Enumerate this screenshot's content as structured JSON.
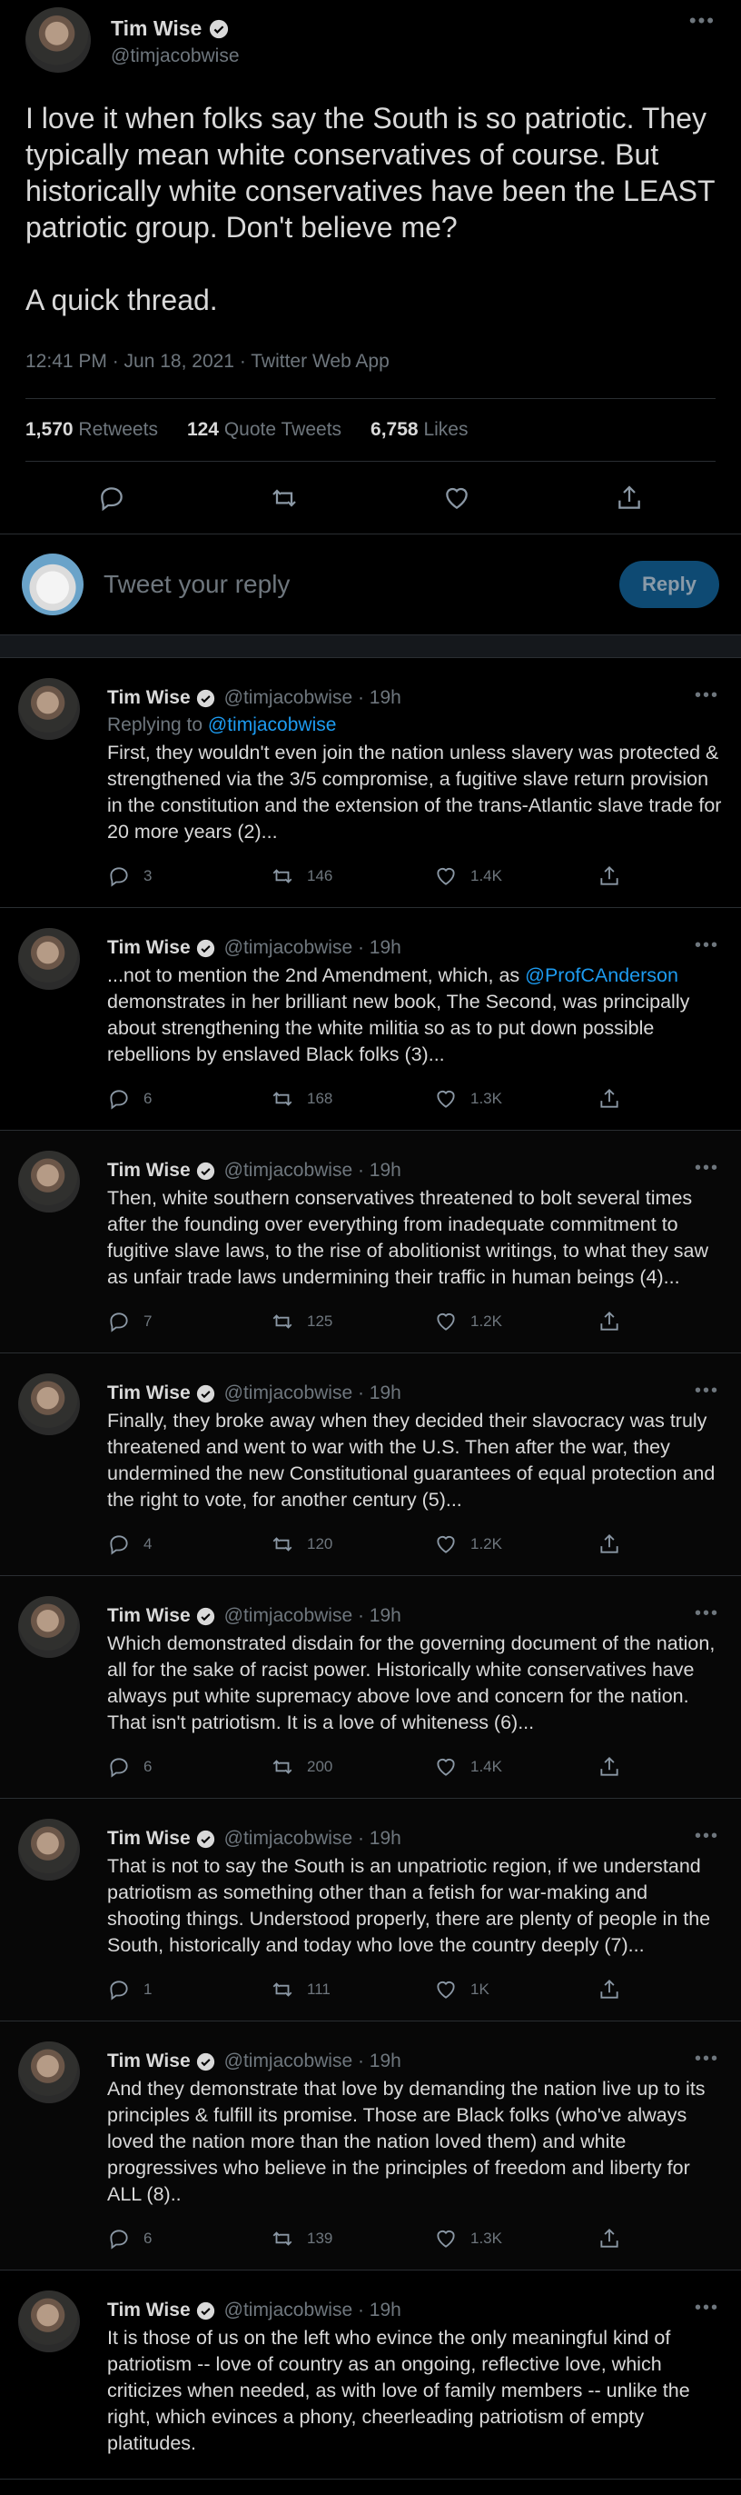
{
  "main": {
    "name": "Tim Wise",
    "handle": "@timjacobwise",
    "paragraphs": [
      "I love it when folks say the South is so patriotic. They typically mean white conservatives of course. But historically white conservatives have been the LEAST patriotic group. Don't believe me?",
      "A quick thread."
    ],
    "meta": "12:41 PM · Jun 18, 2021 · Twitter Web App",
    "retweets_count": "1,570",
    "retweets_label": "Retweets",
    "quotes_count": "124",
    "quotes_label": "Quote Tweets",
    "likes_count": "6,758",
    "likes_label": "Likes"
  },
  "reply_box": {
    "placeholder": "Tweet your reply",
    "button": "Reply"
  },
  "thread": [
    {
      "name": "Tim Wise",
      "handle": "@timjacobwise · 19h",
      "replying_prefix": "Replying to ",
      "replying_handle": "@timjacobwise",
      "text": "First, they wouldn't even join the nation unless slavery was protected & strengthened via the 3/5 compromise, a fugitive slave return provision in the constitution and the extension of the trans-Atlantic slave trade for 20 more years (2)...",
      "replies": "3",
      "retweets": "146",
      "likes": "1.4K"
    },
    {
      "name": "Tim Wise",
      "handle": "@timjacobwise · 19h",
      "text_before": "...not to mention the 2nd Amendment, which, as ",
      "mention": "@ProfCAnderson",
      "text_after": " demonstrates in her brilliant new book, The Second, was principally about strengthening the white militia so as to put down possible rebellions by enslaved Black folks (3)...",
      "replies": "6",
      "retweets": "168",
      "likes": "1.3K"
    },
    {
      "name": "Tim Wise",
      "handle": "@timjacobwise · 19h",
      "text": "Then, white southern conservatives threatened to bolt several times after the founding over everything from inadequate commitment to fugitive slave laws, to the rise of abolitionist writings, to what they saw as unfair trade laws undermining their traffic in human beings (4)...",
      "replies": "7",
      "retweets": "125",
      "likes": "1.2K"
    },
    {
      "name": "Tim Wise",
      "handle": "@timjacobwise · 19h",
      "text": "Finally, they broke away when they decided their slavocracy was truly threatened and went to war with the U.S. Then after the war, they undermined the new Constitutional guarantees of equal protection and the right to vote, for another century (5)...",
      "replies": "4",
      "retweets": "120",
      "likes": "1.2K"
    },
    {
      "name": "Tim Wise",
      "handle": "@timjacobwise · 19h",
      "text": "Which demonstrated disdain for the governing document of the nation, all for the sake of racist power. Historically white conservatives have always put white supremacy above love and concern for the nation. That isn't patriotism. It is a love of whiteness (6)...",
      "replies": "6",
      "retweets": "200",
      "likes": "1.4K"
    },
    {
      "name": "Tim Wise",
      "handle": "@timjacobwise · 19h",
      "text": "That is not to say the South is an unpatriotic region, if we understand patriotism as something other than a fetish for war-making and shooting things. Understood properly, there are plenty of people in the South, historically and today who love the country deeply (7)...",
      "replies": "1",
      "retweets": "111",
      "likes": "1K"
    },
    {
      "name": "Tim Wise",
      "handle": "@timjacobwise · 19h",
      "text": "And they demonstrate that love by demanding the nation live up to its principles & fulfill its promise. Those are Black folks (who've always loved the nation more than the nation loved them) and white progressives who believe in the principles of freedom and liberty for ALL (8)..",
      "replies": "6",
      "retweets": "139",
      "likes": "1.3K"
    },
    {
      "name": "Tim Wise",
      "handle": "@timjacobwise · 19h",
      "text": "It is those of us on the left who evince the only meaningful kind of patriotism -- love of country as an ongoing, reflective love, which criticizes when needed, as with love of family members -- unlike the right, which evinces a phony, cheerleading patriotism of empty platitudes."
    }
  ],
  "colors": {
    "accent": "#1d9bf0",
    "muted": "#6e767d",
    "text": "#d9d9d9",
    "background": "#000000"
  },
  "icons": [
    "verified-icon",
    "more-icon",
    "reply-icon",
    "retweet-icon",
    "like-icon",
    "share-icon"
  ]
}
